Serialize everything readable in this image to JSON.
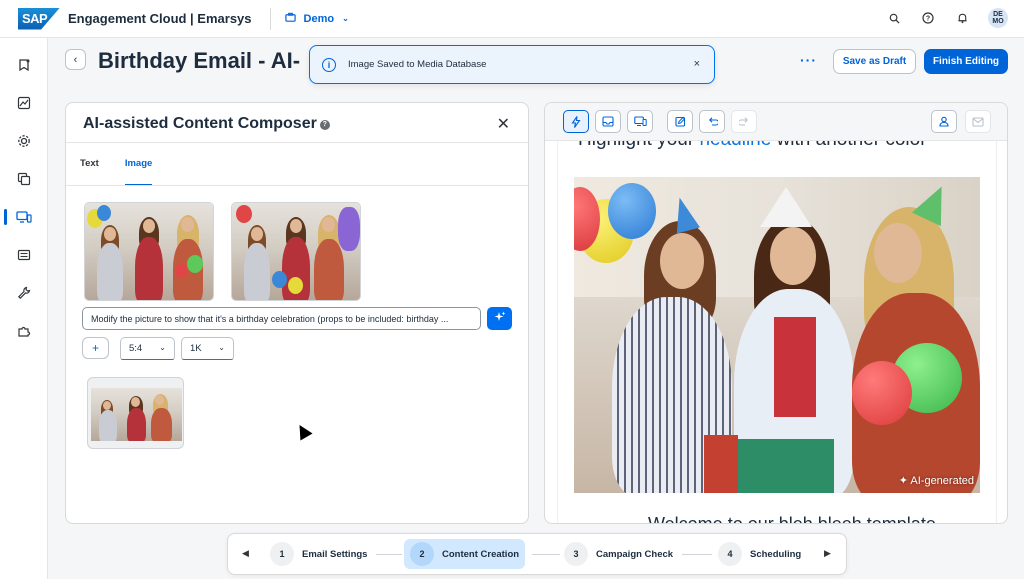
{
  "shell": {
    "logo": "SAP",
    "product": "Engagement Cloud | Emarsys",
    "space": "Demo",
    "avatar": "DE MO",
    "icons": [
      "search-icon",
      "help-icon",
      "bell-icon"
    ]
  },
  "sidenav": {
    "items": [
      "campaigns-icon",
      "analytics-icon",
      "automation-icon",
      "content-icon",
      "channels-icon",
      "contacts-icon",
      "tools-icon",
      "addons-icon"
    ],
    "active_index": 4
  },
  "header": {
    "title": "Birthday Email - AI-",
    "more": "···",
    "save_draft": "Save as Draft",
    "finish": "Finish Editing"
  },
  "toast": {
    "message": "Image Saved to Media Database",
    "close": "×"
  },
  "composer": {
    "title": "AI-assisted Content Composer",
    "help": "?",
    "close": "✕",
    "tabs": [
      {
        "label": "Text",
        "active": false
      },
      {
        "label": "Image",
        "active": true
      }
    ],
    "prompt_value": "Modify the picture to show that it's a birthday celebration (props to be included: birthday ...",
    "add": "+",
    "aspect_ratio": "5:4",
    "resolution": "1K"
  },
  "preview": {
    "headline_start": "Highlight your ",
    "headline_keyword": "headline",
    "headline_end": " with another color",
    "ai_tag": "AI-generated",
    "footer": "Welcome to our bleh bleeh template",
    "colors": {
      "accent": "#0064d9",
      "highlight": "#0b74de"
    }
  },
  "wizard": {
    "prev": "◀",
    "next": "▶",
    "steps": [
      {
        "num": "1",
        "label": "Email Settings"
      },
      {
        "num": "2",
        "label": "Content Creation"
      },
      {
        "num": "3",
        "label": "Campaign Check"
      },
      {
        "num": "4",
        "label": "Scheduling"
      }
    ],
    "active_step": 2
  }
}
